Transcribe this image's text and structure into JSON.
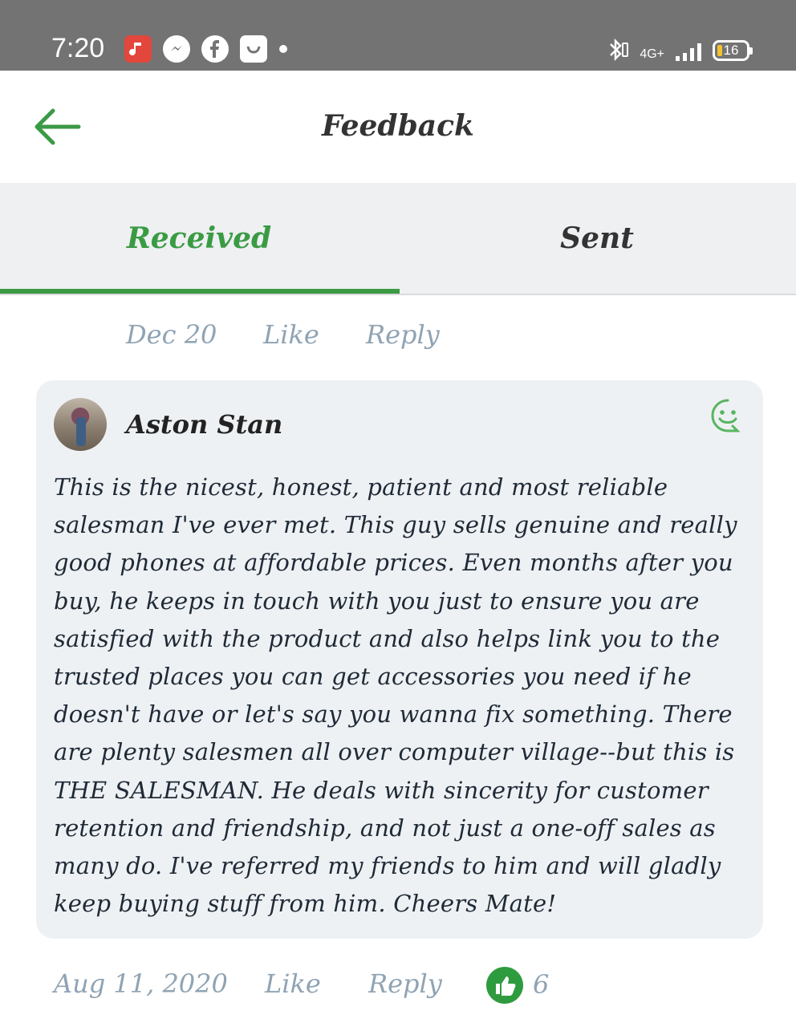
{
  "status_bar": {
    "time": "7:20",
    "icons": [
      "music-icon",
      "messenger-icon",
      "facebook-icon",
      "store-icon",
      "notification-dot-icon"
    ],
    "right_icons": [
      "bluetooth-icon",
      "network-4g-icon",
      "signal-icon",
      "battery-icon"
    ],
    "network_label": "4G+",
    "battery_level": "16"
  },
  "app_bar": {
    "title": "Feedback",
    "back_icon": "back-arrow-icon"
  },
  "tabs": [
    {
      "label": "Received",
      "active": true
    },
    {
      "label": "Sent",
      "active": false
    }
  ],
  "prev_item": {
    "date": "Dec 20",
    "like_label": "Like",
    "reply_label": "Reply"
  },
  "feedback": {
    "author": "Aston Stan",
    "text": "This is the nicest, honest, patient and most reliable salesman I've ever met. This guy sells genuine and really good phones at affordable prices. Even months after you buy, he keeps in touch with you just to ensure you are satisfied with the product and also helps link you to the trusted places you can get accessories you need if he doesn't have or let's say you wanna fix something. There are plenty salesmen all over computer village--but this is THE SALESMAN. He deals with sincerity for customer retention and friendship, and not just a one-off sales as many do. I've referred my friends to him and will gladly keep buying stuff from him. Cheers Mate!",
    "date": "Aug 11, 2020",
    "like_label": "Like",
    "reply_label": "Reply",
    "like_count": "6",
    "sentiment_icon": "smile-icon"
  },
  "colors": {
    "accent": "#3c9a45",
    "muted_text": "#8fa3b3",
    "status_bar": "#737373",
    "card_bg": "#eef1f4"
  }
}
